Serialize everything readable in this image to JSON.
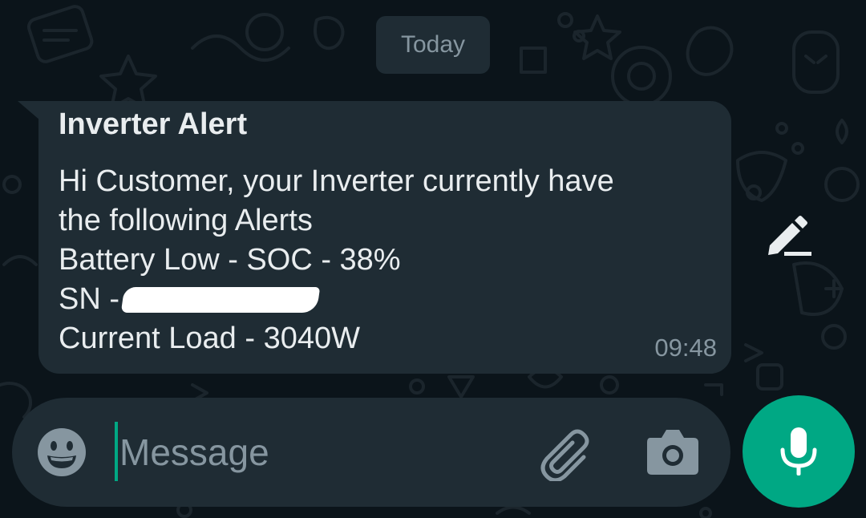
{
  "date_chip": "Today",
  "message": {
    "sender": "Inverter Alert",
    "lines": [
      "Hi Customer, your Inverter currently have",
      "the following Alerts",
      "Battery Low - SOC - 38%",
      "SN -",
      "Current Load - 3040W"
    ],
    "time": "09:48"
  },
  "composer": {
    "placeholder": "Message"
  },
  "icons": {
    "emoji": "emoji-icon",
    "attach": "paperclip-icon",
    "camera": "camera-icon",
    "mic": "microphone-icon",
    "edit": "pencil-icon"
  },
  "colors": {
    "background": "#0b141a",
    "bubble": "#1f2c34",
    "accent": "#00a884",
    "text_primary": "#e9edef",
    "text_secondary": "#8696a0"
  }
}
